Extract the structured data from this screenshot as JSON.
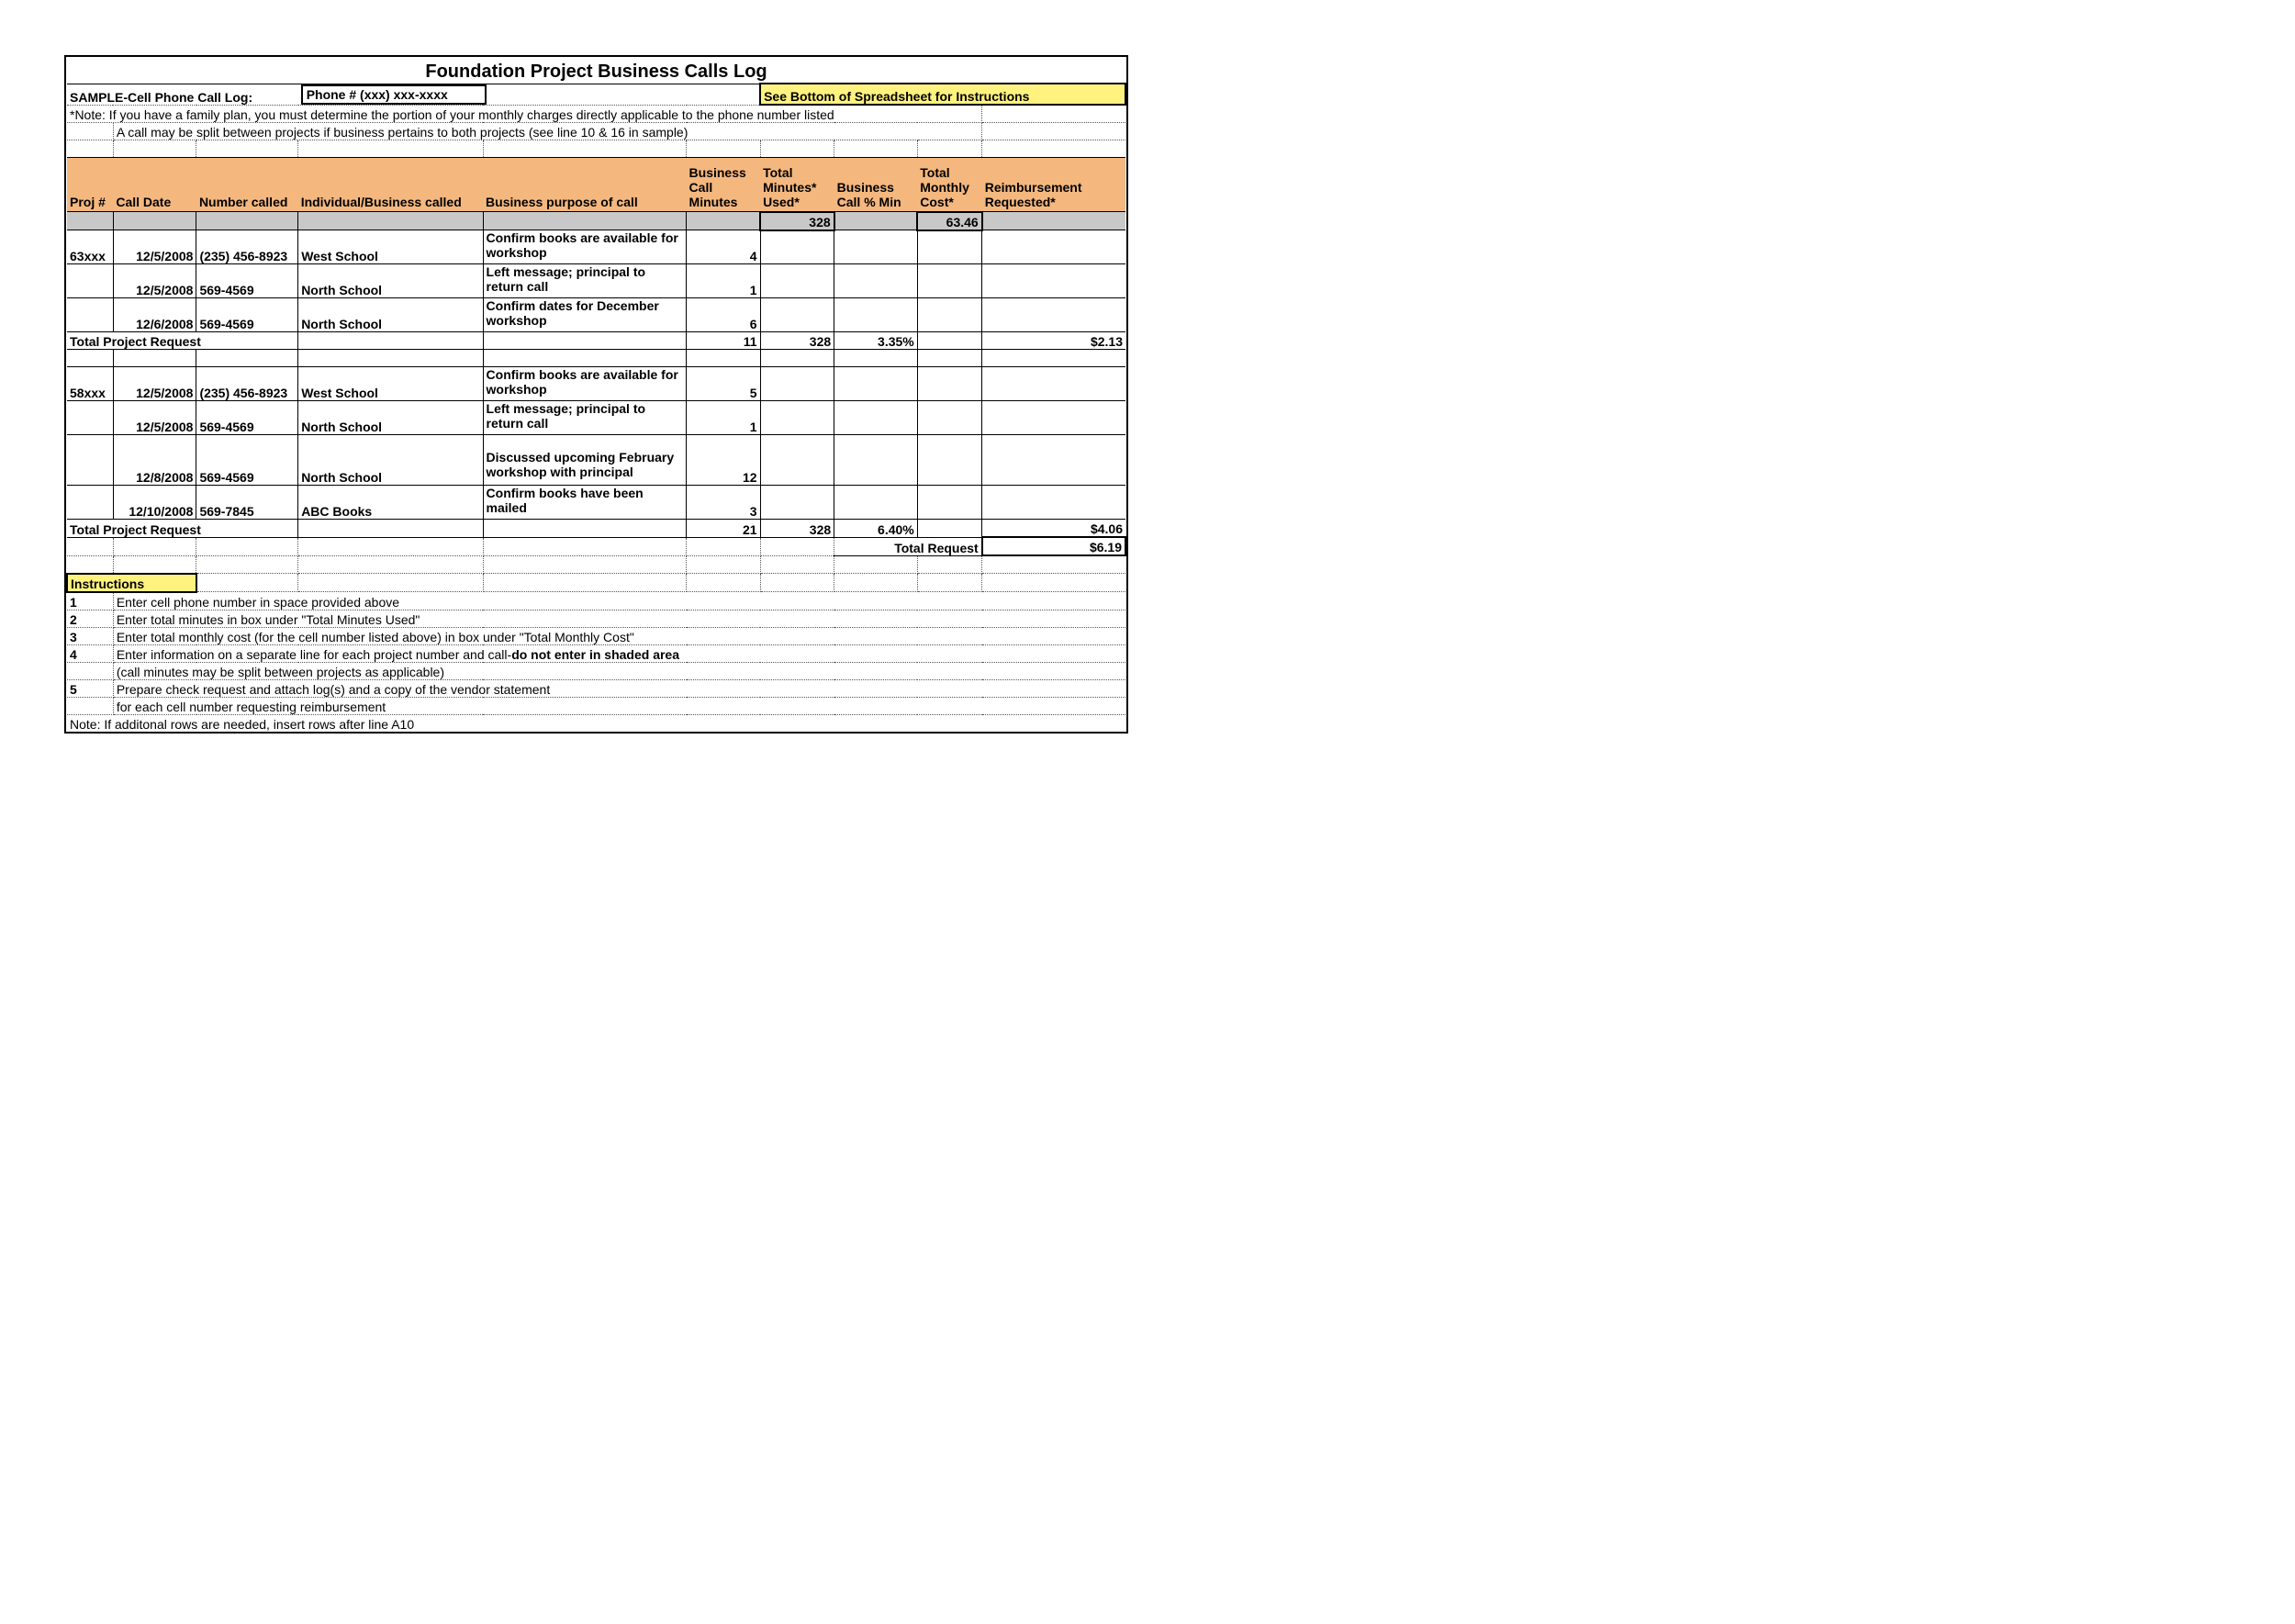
{
  "title": "Foundation Project Business Calls Log",
  "sample_label": "SAMPLE-Cell Phone Call Log:",
  "phone_label": "Phone # (xxx) xxx-xxxx",
  "see_bottom": "See Bottom of Spreadsheet for Instructions",
  "note1": "*Note:  If you have a family plan, you must determine the portion of your monthly charges directly applicable to the phone number listed",
  "note2": "A call may be split between projects if business pertains to both projects (see line 10 & 16 in sample)",
  "headers": {
    "proj": "Proj #",
    "date": "Call Date",
    "number": "Number called",
    "ind": "Individual/Business called",
    "purpose": "Business purpose of call",
    "minutes": "Business Call Minutes",
    "total_min": "Total Minutes* Used*",
    "pct": "Business Call % Min",
    "cost": "Total Monthly Cost*",
    "reimb": "Reimbursement Requested*"
  },
  "top_totals": {
    "minutes": "328",
    "cost": "63.46"
  },
  "proj1": {
    "id": "63xxx",
    "rows": [
      {
        "date": "12/5/2008",
        "num": "(235) 456-8923",
        "ind": "West School",
        "purpose": "Confirm books are available for workshop",
        "min": "4"
      },
      {
        "date": "12/5/2008",
        "num": "569-4569",
        "ind": "North School",
        "purpose": "Left message; principal to return call",
        "min": "1"
      },
      {
        "date": "12/6/2008",
        "num": "569-4569",
        "ind": "North School",
        "purpose": "Confirm dates for December workshop",
        "min": "6"
      }
    ],
    "total_label": "Total Project Request",
    "total": {
      "min": "11",
      "used": "328",
      "pct": "3.35%",
      "reimb": "$2.13"
    }
  },
  "proj2": {
    "id": "58xxx",
    "rows": [
      {
        "date": "12/5/2008",
        "num": "(235) 456-8923",
        "ind": "West School",
        "purpose": "Confirm books are available for workshop",
        "min": "5"
      },
      {
        "date": "12/5/2008",
        "num": "569-4569",
        "ind": "North School",
        "purpose": "Left message; principal to return call",
        "min": "1"
      },
      {
        "date": "12/8/2008",
        "num": "569-4569",
        "ind": "North School",
        "purpose": "Discussed upcoming February workshop with principal",
        "min": "12"
      },
      {
        "date": "12/10/2008",
        "num": "569-7845",
        "ind": "ABC Books",
        "purpose": "Confirm books have been mailed",
        "min": "3"
      }
    ],
    "total_label": "Total Project Request",
    "total": {
      "min": "21",
      "used": "328",
      "pct": "6.40%",
      "reimb": "$4.06"
    }
  },
  "grand": {
    "label": "Total Request",
    "amount": "$6.19"
  },
  "instructions_label": "Instructions",
  "instructions": {
    "n1": "1",
    "t1": "Enter cell phone number in space provided above",
    "n2": "2",
    "t2": "Enter total minutes in box under \"Total Minutes Used\"",
    "n3": "3",
    "t3": "Enter total monthly cost (for the cell number listed above) in box under \"Total Monthly Cost\"",
    "n4": "4",
    "t4a": "Enter information on a separate line for each project number and call-",
    "t4b": "do not enter in shaded area",
    "t4c": "(call minutes may be split between projects as applicable)",
    "n5": "5",
    "t5": "Prepare check request and attach log(s) and a copy of the vendor statement",
    "t5b": "for each cell number requesting reimbursement",
    "note": "Note: If additonal rows are needed, insert rows after line A10"
  }
}
